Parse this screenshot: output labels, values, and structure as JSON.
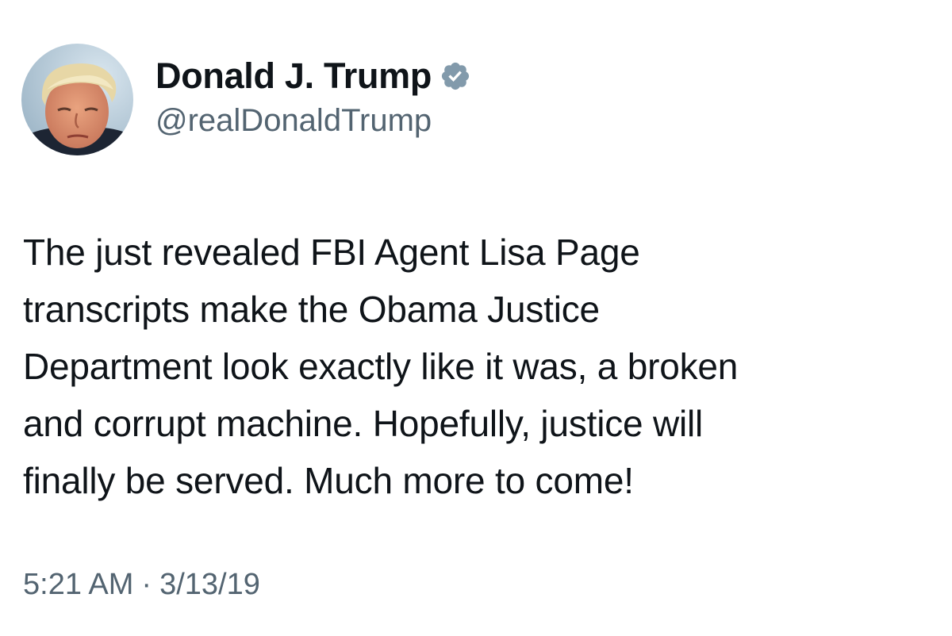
{
  "tweet": {
    "author": {
      "display_name": "Donald J. Trump",
      "handle": "@realDonaldTrump",
      "verified_icon": "verified-badge-icon",
      "avatar": "profile-photo"
    },
    "text": "The just revealed FBI Agent Lisa Page\ntranscripts make the Obama Justice\nDepartment look exactly like it was, a broken\nand corrupt machine. Hopefully, justice will\nfinally be served. Much more to come!",
    "time": "5:21 AM",
    "separator": "·",
    "date": "3/13/19"
  },
  "colors": {
    "text_primary": "#0f1419",
    "text_secondary": "#536471",
    "verified_badge": "#829aab",
    "background": "#ffffff"
  }
}
